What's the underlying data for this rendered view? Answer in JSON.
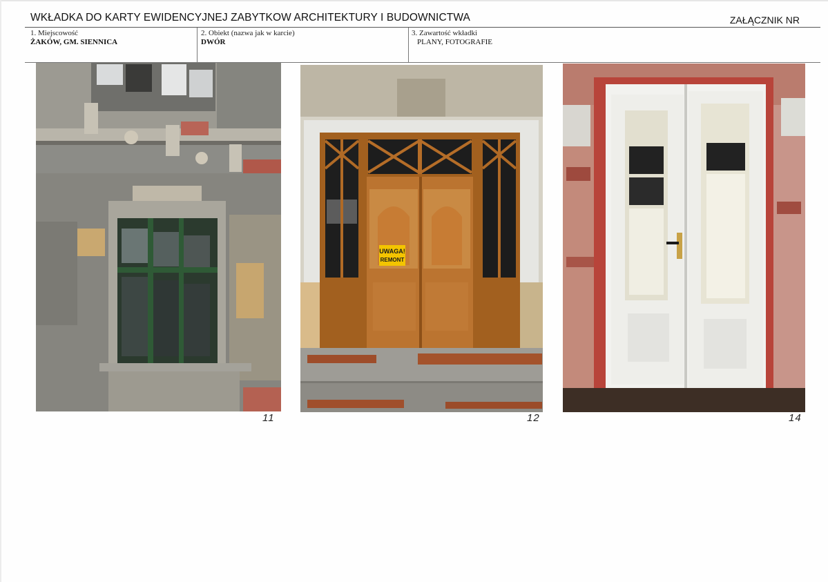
{
  "header": {
    "title": "WKŁADKA DO KARTY EWIDENCYJNEJ ZABYTKOW ARCHITEKTURY I BUDOWNICTWA",
    "attachment_label": "ZAŁĄCZNIK NR"
  },
  "fields": [
    {
      "label": "1. Miejscowość",
      "value": "ŻAKÓW, GM. SIENNICA"
    },
    {
      "label": "2. Obiekt (nazwa jak w karcie)",
      "value": "DWÓR"
    },
    {
      "label": "3. Zawartość wkładki",
      "value": "PLANY, FOTOGRAFIE"
    }
  ],
  "photos": [
    {
      "subject": "facade-window",
      "number": "11"
    },
    {
      "subject": "entrance-door-wooden",
      "number": "12",
      "sign": {
        "line1": "UWAGA!",
        "line2": "REMONT"
      }
    },
    {
      "subject": "white-double-door",
      "number": "14"
    }
  ],
  "colors": {
    "rule": "#555555",
    "door_wood": "#b9712e",
    "plaster": "#8a8a86",
    "brick": "#b2574a",
    "sign_yellow": "#f3c400"
  }
}
